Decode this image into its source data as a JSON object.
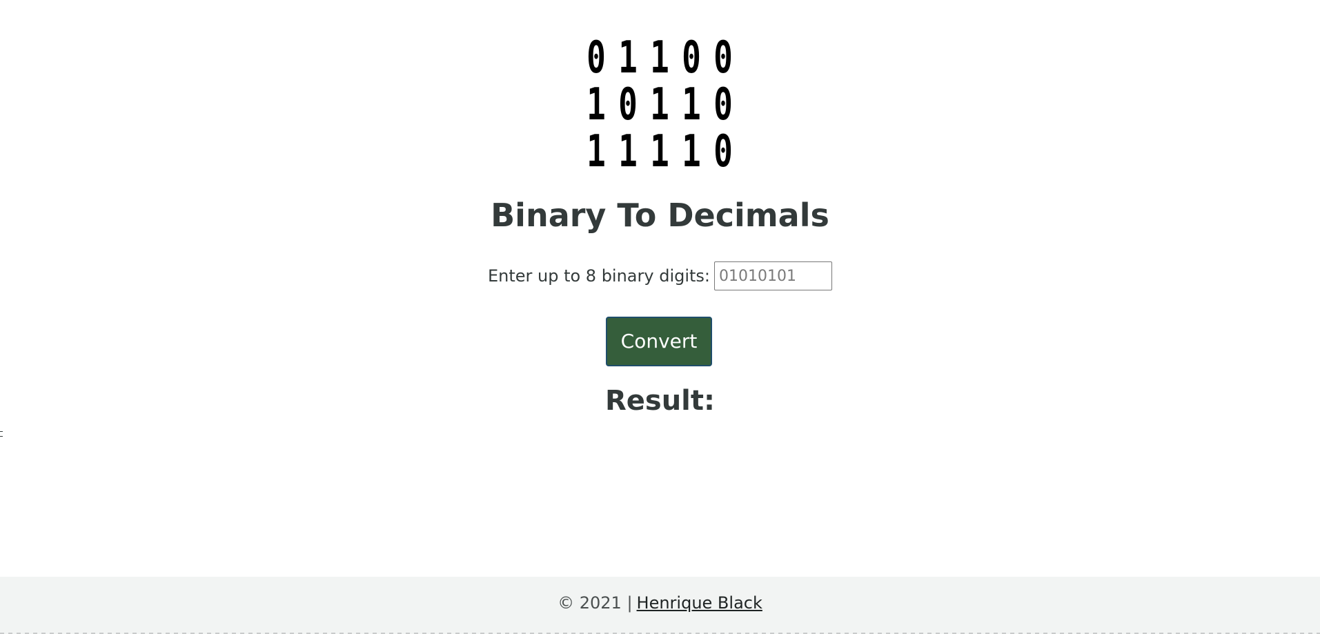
{
  "logo": {
    "rows": [
      [
        "0",
        "1",
        "1",
        "0",
        "0"
      ],
      [
        "1",
        "0",
        "1",
        "1",
        "0"
      ],
      [
        "1",
        "1",
        "1",
        "1",
        "0"
      ]
    ]
  },
  "header": {
    "title": "Binary To Decimals"
  },
  "form": {
    "label": "Enter up to 8 binary digits:",
    "input_value": "",
    "input_placeholder": "01010101",
    "button_label": "Convert"
  },
  "result": {
    "heading": "Result:",
    "value": ""
  },
  "footer": {
    "copyright": "© 2021 |",
    "author": "Henrique Black"
  },
  "colors": {
    "button_bg": "#355e3b",
    "button_border": "#1f4e6b",
    "text": "#333a3a",
    "footer_bg": "#f2f4f3"
  }
}
